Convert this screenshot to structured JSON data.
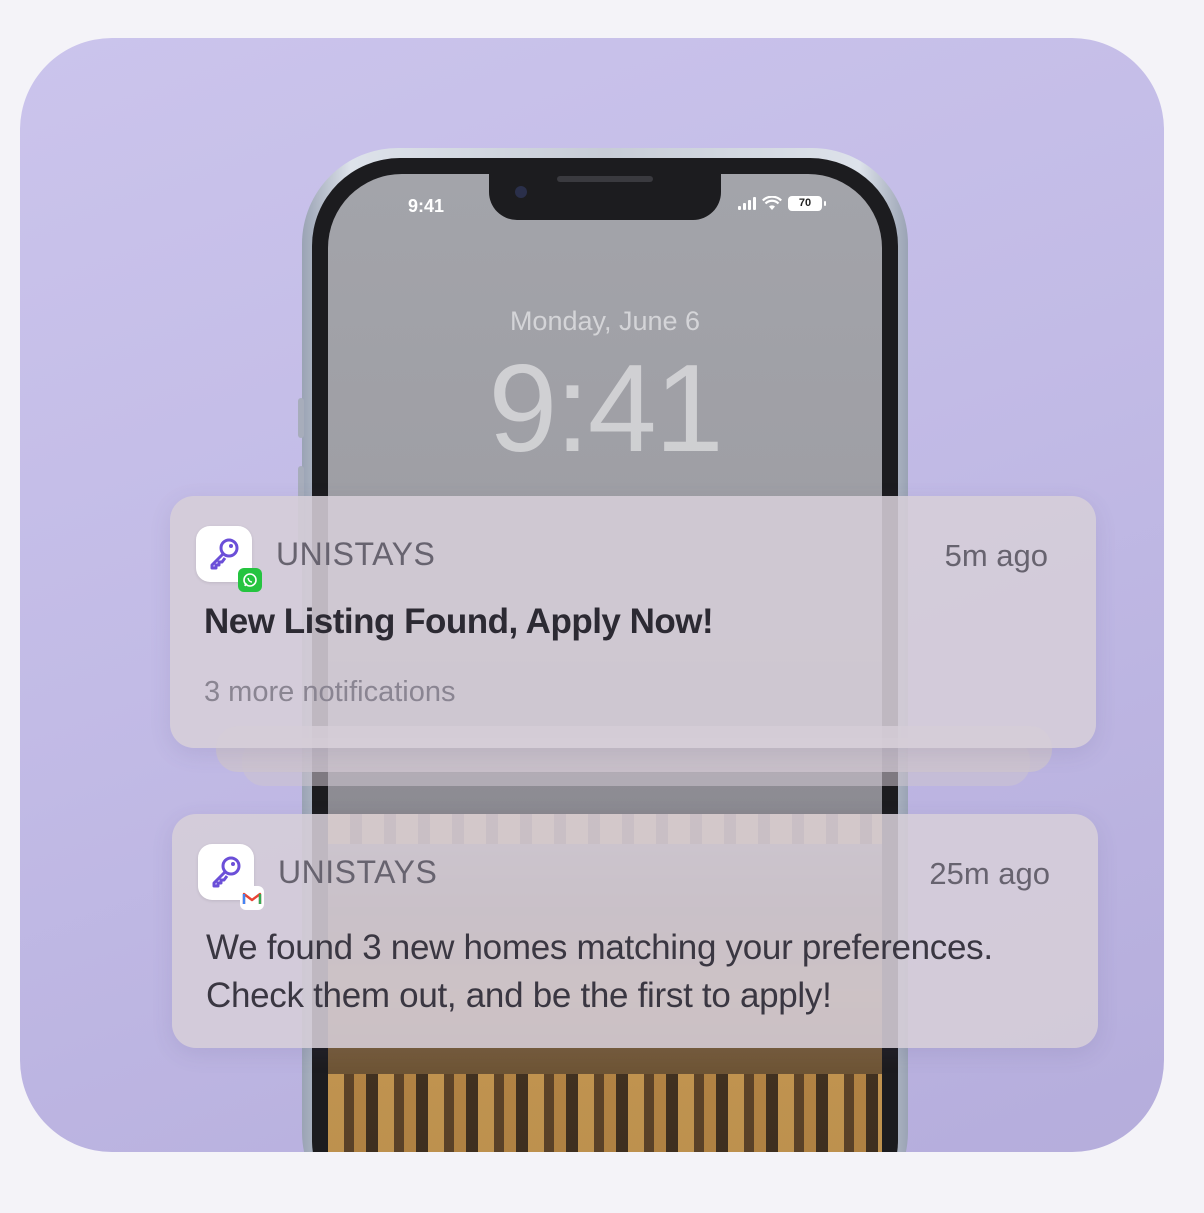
{
  "status_bar": {
    "time": "9:41",
    "battery": "70"
  },
  "lock_screen": {
    "date": "Monday, June 6",
    "time": "9:41"
  },
  "notifications": [
    {
      "app": "UNISTAYS",
      "time_ago": "5m ago",
      "title": "New Listing Found, Apply Now!",
      "more": "3 more notifications",
      "badge_icon": "whatsapp-icon",
      "badge_color": "#25c440"
    },
    {
      "app": "UNISTAYS",
      "time_ago": "25m ago",
      "body_line1": "We found 3 new homes matching your preferences.",
      "body_line2": "Check them out, and be the first to apply!",
      "badge_icon": "gmail-icon"
    }
  ],
  "colors": {
    "background": "#cbc4ec",
    "brand_key": "#6b4fd8"
  }
}
